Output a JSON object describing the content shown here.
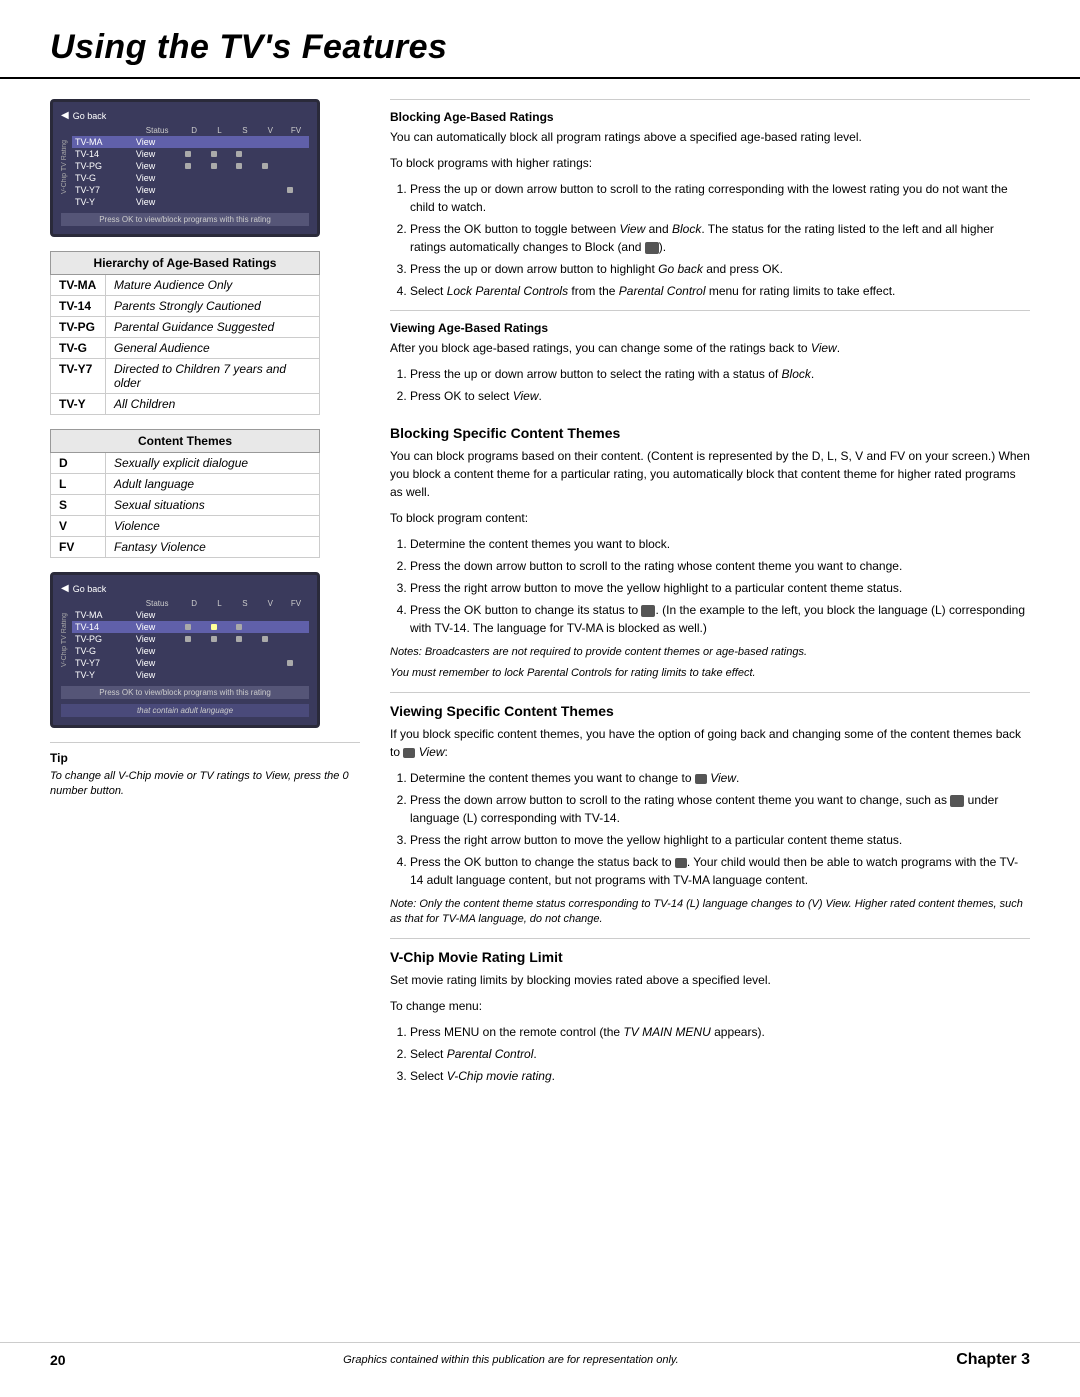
{
  "header": {
    "title": "Using the TV's Features"
  },
  "left": {
    "hierarchy_table": {
      "title": "Hierarchy of Age-Based Ratings",
      "rows": [
        {
          "code": "TV-MA",
          "description": "Mature Audience Only"
        },
        {
          "code": "TV-14",
          "description": "Parents Strongly Cautioned"
        },
        {
          "code": "TV-PG",
          "description": "Parental Guidance Suggested"
        },
        {
          "code": "TV-G",
          "description": "General Audience"
        },
        {
          "code": "TV-Y7",
          "description": "Directed to Children 7 years and older"
        },
        {
          "code": "TV-Y",
          "description": "All Children"
        }
      ]
    },
    "content_themes_table": {
      "title": "Content Themes",
      "rows": [
        {
          "code": "D",
          "description": "Sexually explicit dialogue"
        },
        {
          "code": "L",
          "description": "Adult language"
        },
        {
          "code": "S",
          "description": "Sexual situations"
        },
        {
          "code": "V",
          "description": "Violence"
        },
        {
          "code": "FV",
          "description": "Fantasy Violence"
        }
      ]
    },
    "tip": {
      "label": "Tip",
      "text": "To change all V-Chip movie or TV ratings to View, press the 0 number button."
    }
  },
  "right": {
    "blocking_age": {
      "title": "Blocking Age-Based Ratings",
      "intro": "You can automatically block all program ratings above a specified age-based rating level.",
      "subtext": "To block programs with higher ratings:",
      "steps": [
        "Press the up or down arrow button to scroll to the rating corresponding with the lowest rating you do not want the child to watch.",
        "Press the OK button to toggle between View and Block. The status for the rating listed to the left and all higher ratings automatically changes to Block (and  ).",
        "Press the up or down arrow button to highlight Go back and press OK.",
        "Select Lock Parental Controls from the Parental Control menu for rating limits to take effect."
      ]
    },
    "viewing_age": {
      "title": "Viewing Age-Based Ratings",
      "intro": "After you block age-based ratings, you can change some of the ratings back to View.",
      "steps": [
        "Press the up or down arrow button to select the rating with a status of Block.",
        "Press OK to select View."
      ]
    },
    "blocking_specific": {
      "title": "Blocking Specific Content Themes",
      "intro": "You can block programs based on their content. (Content is represented by the D, L, S, V and FV on your screen.) When you block a content theme for a particular rating, you automatically block that content theme for higher rated programs as well.",
      "subtext": "To block program content:",
      "steps": [
        "Determine the content themes you want to block.",
        "Press the down arrow button to scroll to the rating whose content theme you want to change.",
        "Press the right arrow button to move the yellow highlight to a particular content theme status.",
        "Press the OK button to change its status to  . (In the example to the left, you block the language (L) corresponding with TV-14. The language for TV-MA is blocked as well.)"
      ],
      "note1": "Notes: Broadcasters are not required to provide content themes or age-based ratings.",
      "note2": "You must remember to lock Parental Controls for rating limits to take effect."
    },
    "viewing_specific": {
      "title": "Viewing Specific Content Themes",
      "intro": "If you block specific content themes, you have the option of going back and changing some of the content themes back to  View:",
      "steps": [
        "Determine the content themes you want to change to  View.",
        "Press the down arrow button to scroll to the rating whose content theme you want to change, such as  under language (L) corresponding with TV-14.",
        "Press the right arrow button to move the yellow highlight to a particular content theme status.",
        "Press the OK button to change the status back to  . Your child would then be able to watch programs with the TV-14 adult language content, but not programs with TV-MA language content."
      ],
      "note": "Note: Only the content theme status corresponding to TV-14 (L) language changes to (V) View. Higher rated content themes, such as that for TV-MA language, do not change."
    },
    "vchip": {
      "title": "V-Chip Movie Rating Limit",
      "intro": "Set movie rating limits by blocking movies rated above a specified level.",
      "subtext": "To change menu:",
      "steps": [
        "Press MENU on the remote control (the TV MAIN MENU appears).",
        "Select Parental Control.",
        "Select V-Chip movie rating."
      ]
    }
  },
  "footer": {
    "page_number": "20",
    "center_text": "Graphics contained within this publication are for representation only.",
    "chapter": "Chapter 3"
  }
}
